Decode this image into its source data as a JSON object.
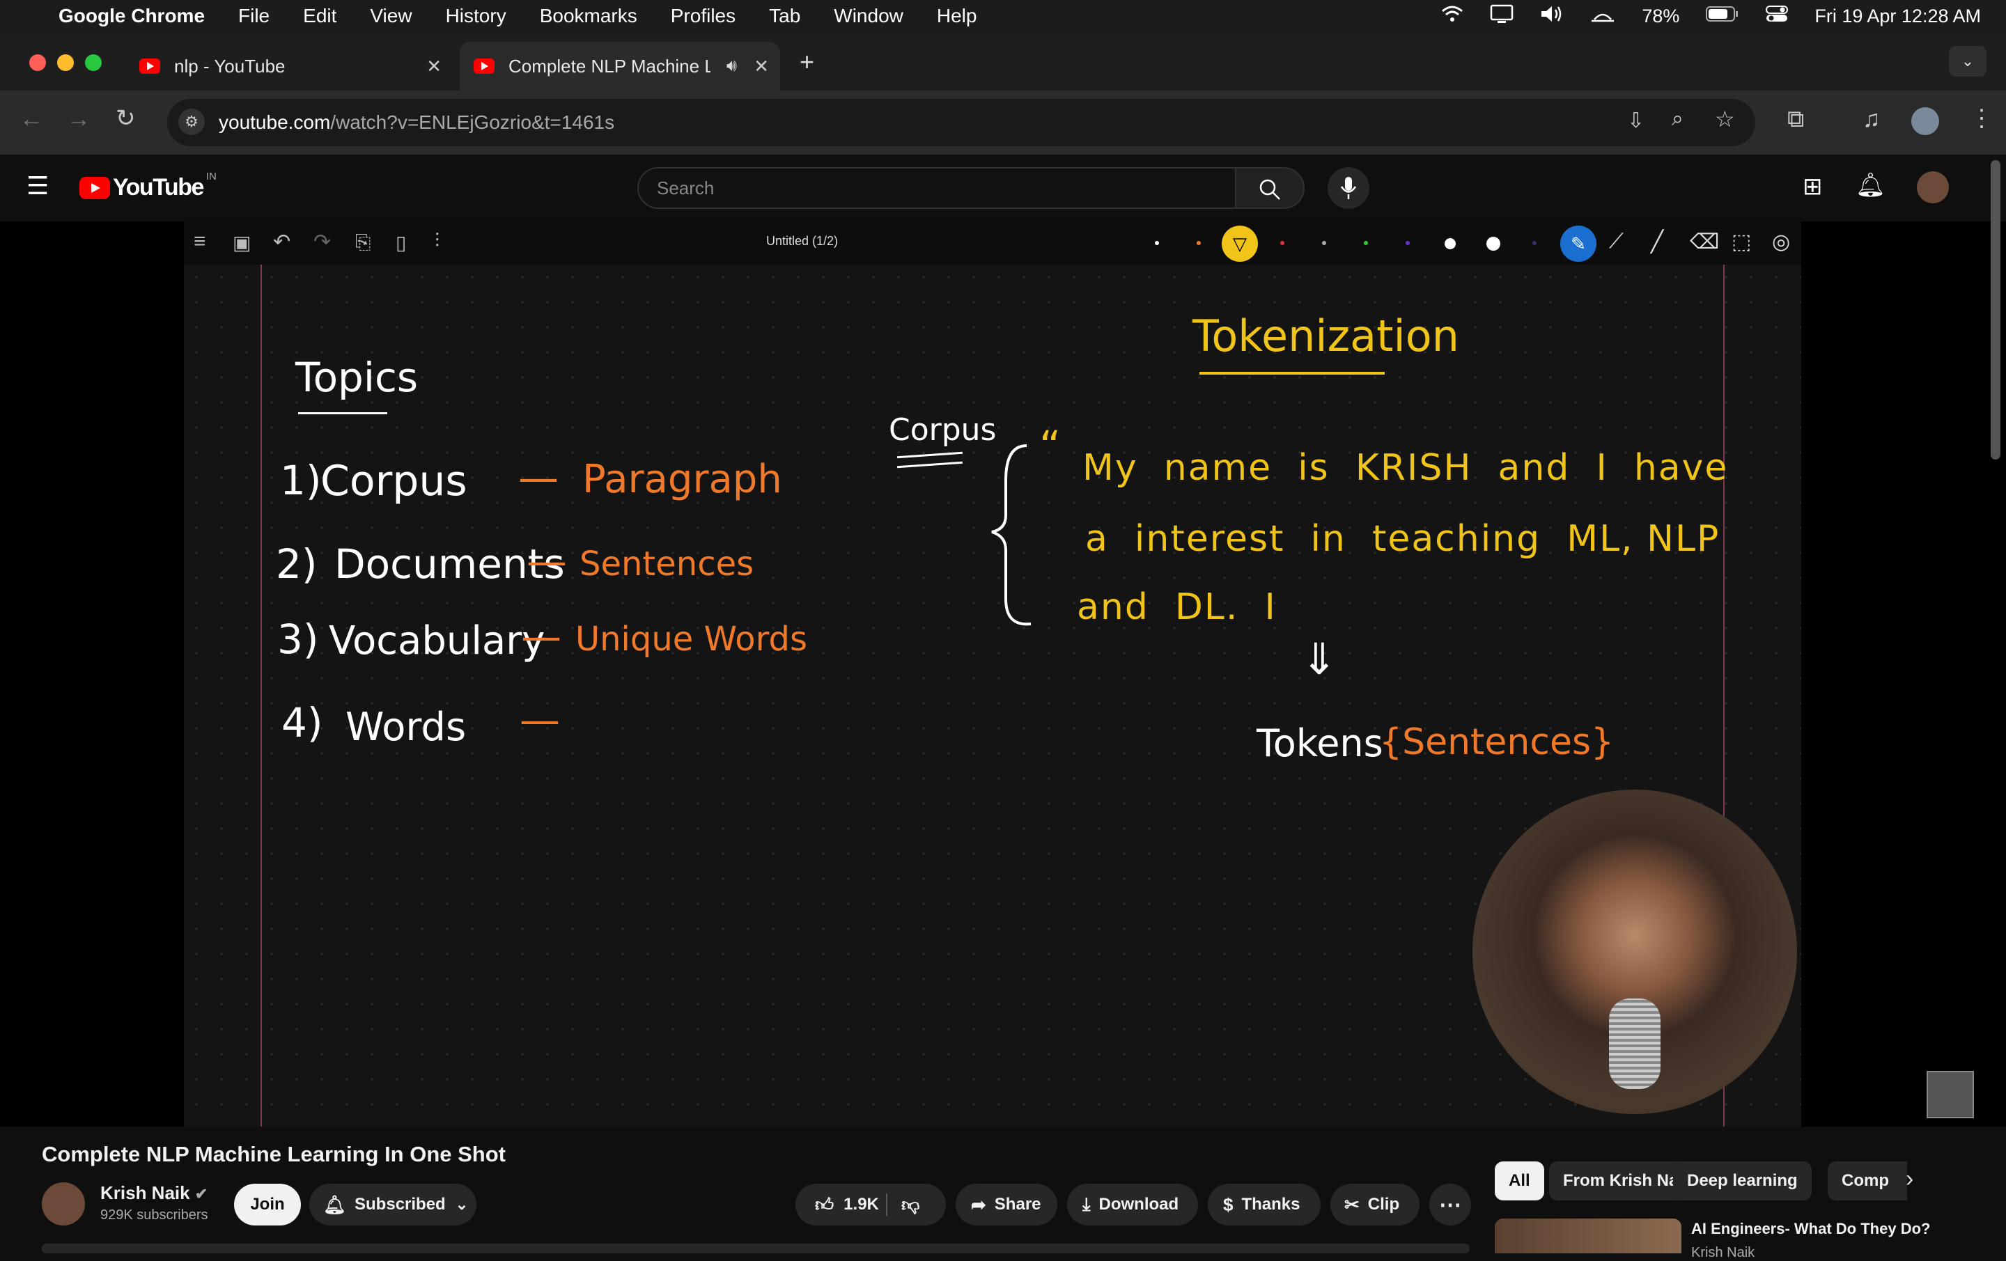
{
  "menubar": {
    "app": "Google Chrome",
    "items": [
      "File",
      "Edit",
      "View",
      "History",
      "Bookmarks",
      "Profiles",
      "Tab",
      "Window",
      "Help"
    ],
    "battery": "78%",
    "datetime": "Fri 19 Apr  12:28 AM"
  },
  "tabs": [
    {
      "title": "nlp - YouTube"
    },
    {
      "title": "Complete NLP Machine L"
    }
  ],
  "address": {
    "domain": "youtube.com",
    "path": "/watch?v=ENLEjGozrio&t=1461s"
  },
  "youtube": {
    "logo_text": "YouTube",
    "country": "IN",
    "search_placeholder": "Search"
  },
  "whiteboard": {
    "doc_title": "Untitled (1/2)",
    "title": "Tokenization",
    "topics_heading": "Topics",
    "topics": [
      {
        "num": "1)",
        "term": "Corpus",
        "dash": "—",
        "meaning": "Paragraph"
      },
      {
        "num": "2)",
        "term": "Documents",
        "dash": "—",
        "meaning": "Sentences"
      },
      {
        "num": "3)",
        "term": "Vocabulary",
        "dash": "—",
        "meaning": "Unique Words"
      },
      {
        "num": "4)",
        "term": "Words",
        "dash": "—",
        "meaning": ""
      }
    ],
    "corpus_label": "Corpus",
    "quote_mark": "“",
    "corpus_lines": [
      "My  name  is  KRISH  and  I  have",
      "a  interest  in  teaching  ML, NLP",
      "and  DL.  I"
    ],
    "arrow": "⇓",
    "tokens_label": "Tokens",
    "tokens_value": "{Sentences}"
  },
  "video": {
    "title": "Complete NLP Machine Learning In One Shot",
    "channel": "Krish Naik",
    "subscribers": "929K subscribers",
    "join_label": "Join",
    "subscribed_label": "Subscribed",
    "likes": "1.9K",
    "share_label": "Share",
    "download_label": "Download",
    "thanks_label": "Thanks",
    "clip_label": "Clip"
  },
  "filter_chips": [
    "All",
    "From Krish Naik",
    "Deep learning",
    "Comp"
  ],
  "recommended": [
    {
      "title": "AI Engineers- What Do They Do?",
      "channel": "Krish Naik"
    }
  ],
  "colors": {
    "youtube_red": "#ff0000",
    "whiteboard_title": "#f0c419",
    "whiteboard_meaning": "#f07a2a",
    "whiteboard_text": "#ffffff",
    "tab_active_bg": "#2b2b2b"
  }
}
